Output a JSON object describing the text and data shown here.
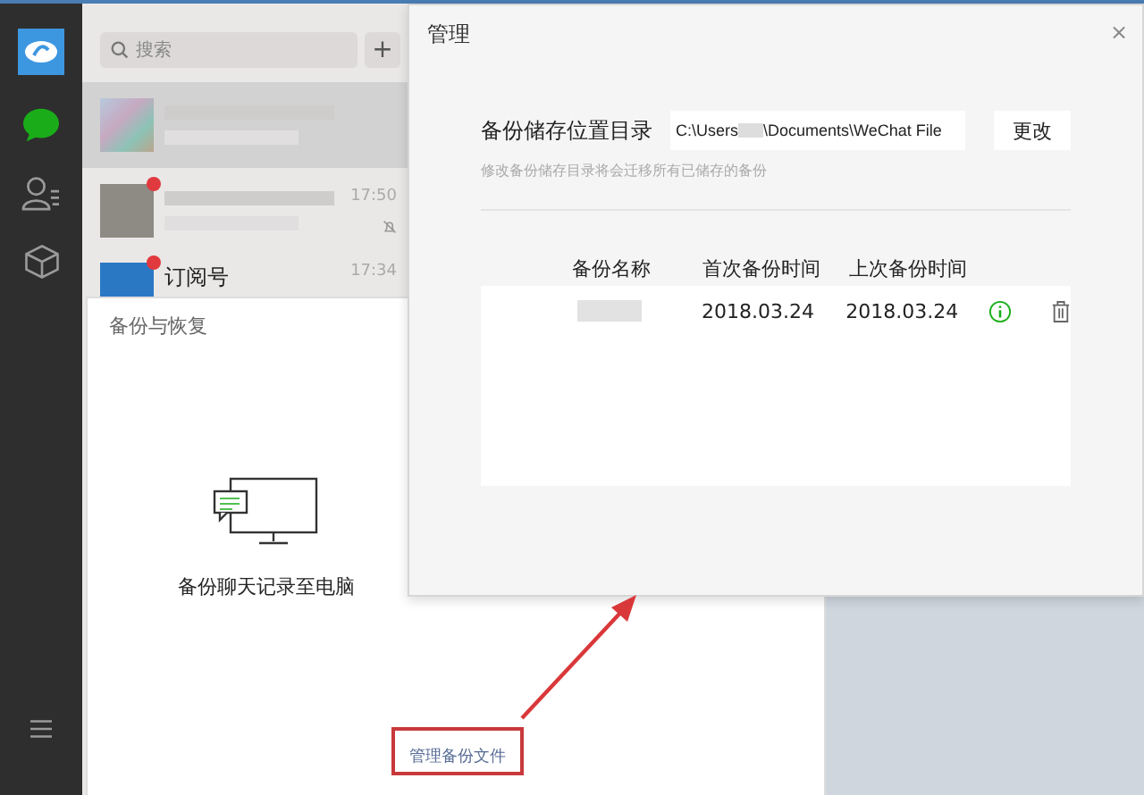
{
  "sidebar": {
    "items": [
      {
        "kind": "chat",
        "selected": true
      },
      {
        "kind": "contacts",
        "selected": false
      },
      {
        "kind": "box",
        "selected": false
      }
    ]
  },
  "chat_list": {
    "search": {
      "placeholder": "搜索"
    },
    "add_button": "+",
    "rows": [
      {
        "selected": true,
        "unread": false,
        "muted": false
      },
      {
        "selected": false,
        "unread": true,
        "muted": true,
        "time": "17:50"
      },
      {
        "selected": false,
        "unread": true,
        "muted": false,
        "name": "订阅号",
        "time": "17:34"
      }
    ]
  },
  "backup_dialog": {
    "title": "备份与恢复",
    "option": "备份聊天记录至电脑",
    "link": "管理备份文件"
  },
  "manage_dialog": {
    "title": "管理",
    "close": "×",
    "directory_label": "备份储存位置目录",
    "path_start": "C:\\Users",
    "path_end": "\\Documents\\WeChat File",
    "change_button": "更改",
    "hint": "修改备份储存目录将会迁移所有已储存的备份",
    "columns": [
      "备份名称",
      "首次备份时间",
      "上次备份时间"
    ],
    "rows": [
      {
        "first_backup": "2018.03.24",
        "last_backup": "2018.03.24"
      }
    ]
  }
}
